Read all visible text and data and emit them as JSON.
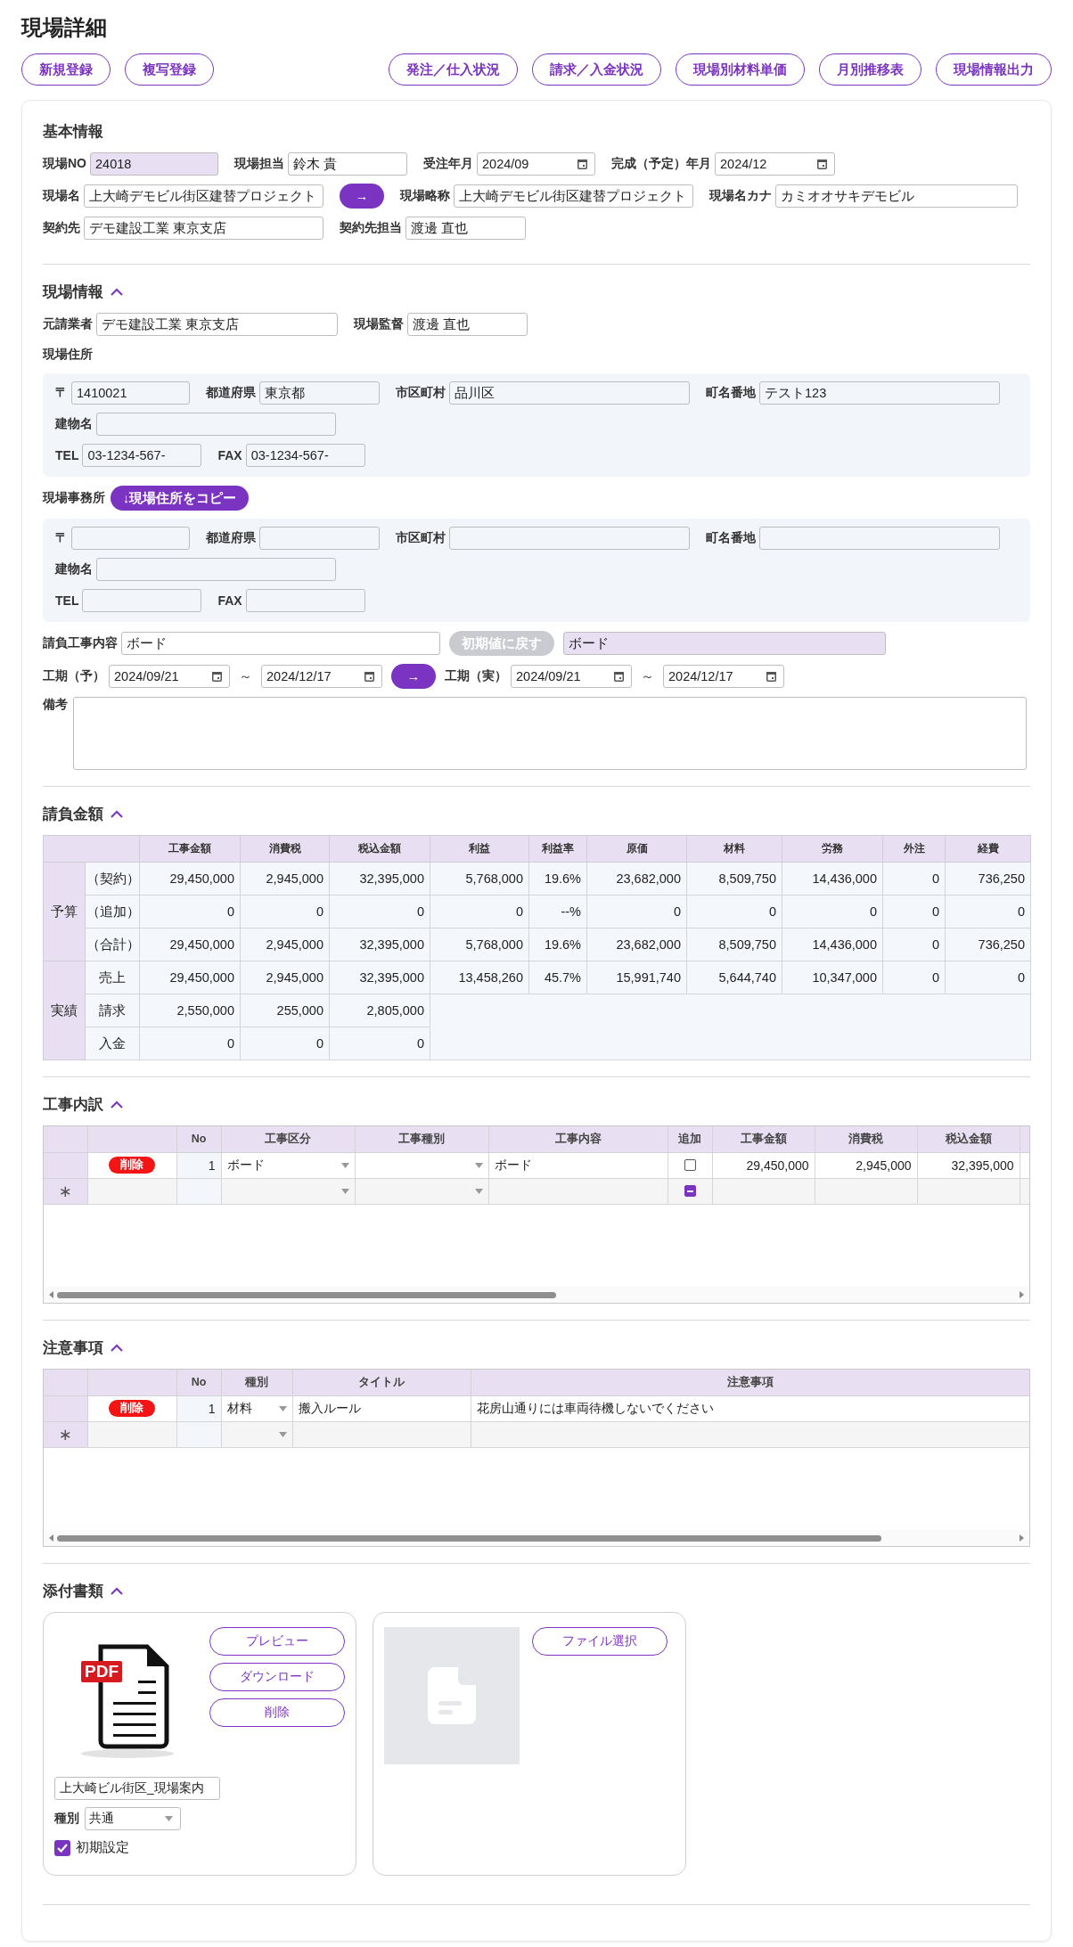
{
  "page_title": "現場詳細",
  "toolbar": {
    "left": [
      "新規登録",
      "複写登録"
    ],
    "right": [
      "発注／仕入状況",
      "請求／入金状況",
      "現場別材料単価",
      "月別推移表",
      "現場情報出力"
    ]
  },
  "basic_info": {
    "title": "基本情報",
    "rows": [
      [
        {
          "kind": "readonly",
          "label": "現場NO",
          "value": "24018"
        },
        {
          "kind": "input",
          "label": "現場担当",
          "value": "鈴木 貴"
        },
        {
          "kind": "date",
          "label": "受注年月",
          "value": "2024/09"
        },
        {
          "kind": "date",
          "label": "完成（予定）年月",
          "value": "2024/12"
        }
      ],
      [
        {
          "kind": "input",
          "label": "現場名",
          "value": "上大崎デモビル街区建替プロジェクト"
        },
        {
          "kind": "button",
          "label": "→",
          "disabled": false
        },
        {
          "kind": "input",
          "label": "現場略称",
          "value": "上大崎デモビル街区建替プロジェクト"
        },
        {
          "kind": "input",
          "label": "現場名カナ",
          "value": "カミオオサキデモビル"
        }
      ],
      [
        {
          "kind": "input",
          "label": "契約先",
          "value": "デモ建設工業 東京支店"
        },
        {
          "kind": "input",
          "label": "契約先担当",
          "value": "渡邊 直也"
        }
      ]
    ]
  },
  "site_info": {
    "title": "現場情報",
    "expanded": true,
    "rows": [
      [
        {
          "kind": "input",
          "label": "元請業者",
          "value": "デモ建設工業 東京支店"
        },
        {
          "kind": "input",
          "label": "現場監督",
          "value": "渡邊 直也"
        }
      ]
    ],
    "address": {
      "label": "現場住所",
      "rows": [
        [
          {
            "kind": "input",
            "label": "〒",
            "value": "1410021"
          },
          {
            "kind": "input",
            "label": "都道府県",
            "value": "東京都"
          },
          {
            "kind": "input",
            "label": "市区町村",
            "value": "品川区"
          },
          {
            "kind": "input",
            "label": "町名番地",
            "value": "テスト123"
          }
        ],
        [
          {
            "kind": "input",
            "label": "建物名"
          }
        ],
        [
          {
            "kind": "input",
            "label": "TEL",
            "value": "03-1234-567-"
          },
          {
            "kind": "input",
            "label": "FAX",
            "value": "03-1234-567-"
          }
        ]
      ]
    },
    "office": {
      "label": "現場事務所",
      "copy_button": "↓現場住所をコピー",
      "rows": [
        [
          {
            "kind": "input",
            "label": "〒"
          },
          {
            "kind": "input",
            "label": "都道府県"
          },
          {
            "kind": "input",
            "label": "市区町村"
          },
          {
            "kind": "input",
            "label": "町名番地"
          }
        ],
        [
          {
            "kind": "input",
            "label": "建物名"
          }
        ],
        [
          {
            "kind": "input",
            "label": "TEL"
          },
          {
            "kind": "input",
            "label": "FAX"
          }
        ]
      ]
    },
    "rows_after": [
      [
        {
          "kind": "input",
          "label": "請負工事内容",
          "value": "ボード"
        },
        {
          "kind": "button",
          "label": "初期値に戻す",
          "disabled": true
        },
        {
          "kind": "readonly",
          "value": "ボード"
        }
      ],
      [
        {
          "kind": "date",
          "label": "工期（予）",
          "value": "2024/09/21"
        },
        {
          "kind": "separator",
          "text": "～"
        },
        {
          "kind": "date",
          "value": "2024/12/17"
        },
        {
          "kind": "button",
          "label": "→",
          "disabled": false
        },
        {
          "kind": "date",
          "label": "工期（実）",
          "value": "2024/09/21"
        },
        {
          "kind": "separator",
          "text": "～"
        },
        {
          "kind": "date",
          "value": "2024/12/17"
        }
      ]
    ],
    "remarks": {
      "label": "備考"
    }
  },
  "contract_amount": {
    "title": "請負金額",
    "expanded": true,
    "columns": [
      "工事金額",
      "消費税",
      "税込金額",
      "利益",
      "利益率",
      "原価",
      "材料",
      "労務",
      "外注",
      "経費"
    ],
    "groups": [
      {
        "label": "予算",
        "rows": [
          {
            "label": "（契約）",
            "cells": [
              "29,450,000",
              "2,945,000",
              "32,395,000",
              "5,768,000",
              "19.6%",
              "23,682,000",
              "8,509,750",
              "14,436,000",
              "0",
              "736,250"
            ]
          },
          {
            "label": "（追加）",
            "cells": [
              "0",
              "0",
              "0",
              "0",
              "--%",
              "0",
              "0",
              "0",
              "0",
              "0"
            ]
          },
          {
            "label": "（合計）",
            "cells": [
              "29,450,000",
              "2,945,000",
              "32,395,000",
              "5,768,000",
              "19.6%",
              "23,682,000",
              "8,509,750",
              "14,436,000",
              "0",
              "736,250"
            ]
          }
        ]
      },
      {
        "label": "実績",
        "rows": [
          {
            "label": "売上",
            "cells": [
              "29,450,000",
              "2,945,000",
              "32,395,000",
              "13,458,260",
              "45.7%",
              "15,991,740",
              "5,644,740",
              "10,347,000",
              "0",
              "0"
            ]
          },
          {
            "label": "請求",
            "cells": [
              "2,550,000",
              "255,000",
              "2,805,000"
            ]
          },
          {
            "label": "入金",
            "cells": [
              "0",
              "0",
              "0"
            ]
          }
        ]
      }
    ]
  },
  "work_breakdown": {
    "title": "工事内訳",
    "expanded": true,
    "columns": [
      "No",
      "工事区分",
      "工事種別",
      "工事内容",
      "追加",
      "工事金額",
      "消費税",
      "税込金額"
    ],
    "rows": [
      {
        "delete": "削除",
        "cells": [
          {
            "kind": "number",
            "text": "1"
          },
          {
            "kind": "select",
            "text": "ボード"
          },
          {
            "kind": "select"
          },
          {
            "kind": "text",
            "text": "ボード"
          },
          {
            "kind": "check",
            "checked": false,
            "indeterminate": false
          },
          {
            "kind": "amount",
            "text": "29,450,000"
          },
          {
            "kind": "amount",
            "text": "2,945,000"
          },
          {
            "kind": "amount",
            "text": "32,395,000"
          }
        ]
      }
    ],
    "new_row": {
      "marker": "∗",
      "cells": [
        {
          "kind": "number"
        },
        {
          "kind": "select"
        },
        {
          "kind": "select"
        },
        {
          "kind": "text"
        },
        {
          "kind": "check",
          "indeterminate": true
        },
        {
          "kind": "amount"
        },
        {
          "kind": "amount"
        },
        {
          "kind": "amount"
        }
      ]
    }
  },
  "notes": {
    "title": "注意事項",
    "expanded": true,
    "columns": [
      "No",
      "種別",
      "タイトル",
      "注意事項"
    ],
    "rows": [
      {
        "delete": "削除",
        "cells": [
          {
            "kind": "number",
            "text": "1"
          },
          {
            "kind": "select",
            "text": "材料"
          },
          {
            "kind": "text",
            "text": "搬入ルール"
          },
          {
            "kind": "text",
            "text": "花房山通りには車両待機しないでください"
          }
        ]
      }
    ],
    "new_row": {
      "marker": "∗",
      "cells": [
        {
          "kind": "number"
        },
        {
          "kind": "select"
        },
        {
          "kind": "text"
        },
        {
          "kind": "text"
        }
      ]
    }
  },
  "attachments": {
    "title": "添付書類",
    "expanded": true,
    "files": [
      {
        "kind": "file",
        "badge": "PDF",
        "buttons": [
          "プレビュー",
          "ダウンロード",
          "削除"
        ],
        "file_name": "上大崎ビル街区_現場案内",
        "type_label": "種別",
        "type_value": "共通",
        "default_label": "初期設定",
        "default_checked": true
      },
      {
        "kind": "empty",
        "buttons": [
          "ファイル選択"
        ]
      }
    ]
  }
}
